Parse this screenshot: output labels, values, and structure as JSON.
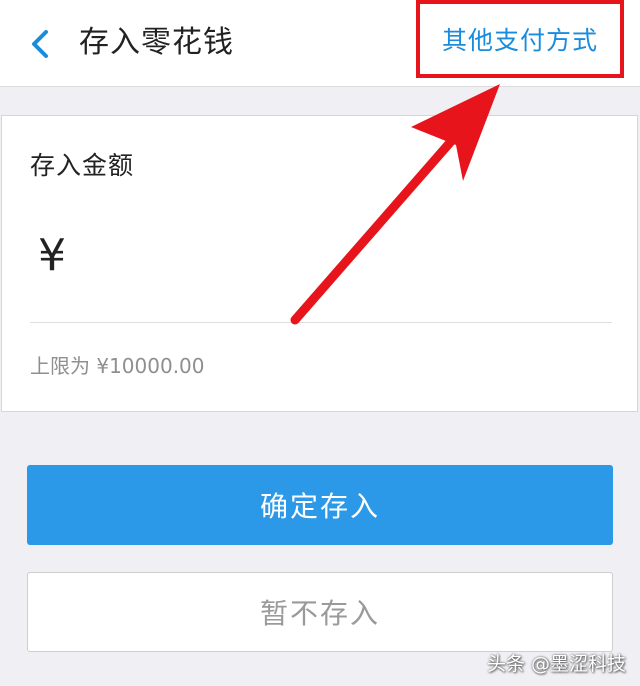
{
  "header": {
    "back_icon": "chevron-left-icon",
    "title": "存入零花钱",
    "other_payment": "其他支付方式"
  },
  "amount_card": {
    "label": "存入金额",
    "currency_symbol": "¥",
    "amount_value": "",
    "limit_text": "上限为 ¥10000.00"
  },
  "buttons": {
    "confirm": "确定存入",
    "skip": "暂不存入"
  },
  "watermark": "头条 @墨涩科技",
  "colors": {
    "accent": "#2b99e8",
    "link": "#1a8cde",
    "annotation": "#e8141b",
    "background": "#efeff4"
  }
}
